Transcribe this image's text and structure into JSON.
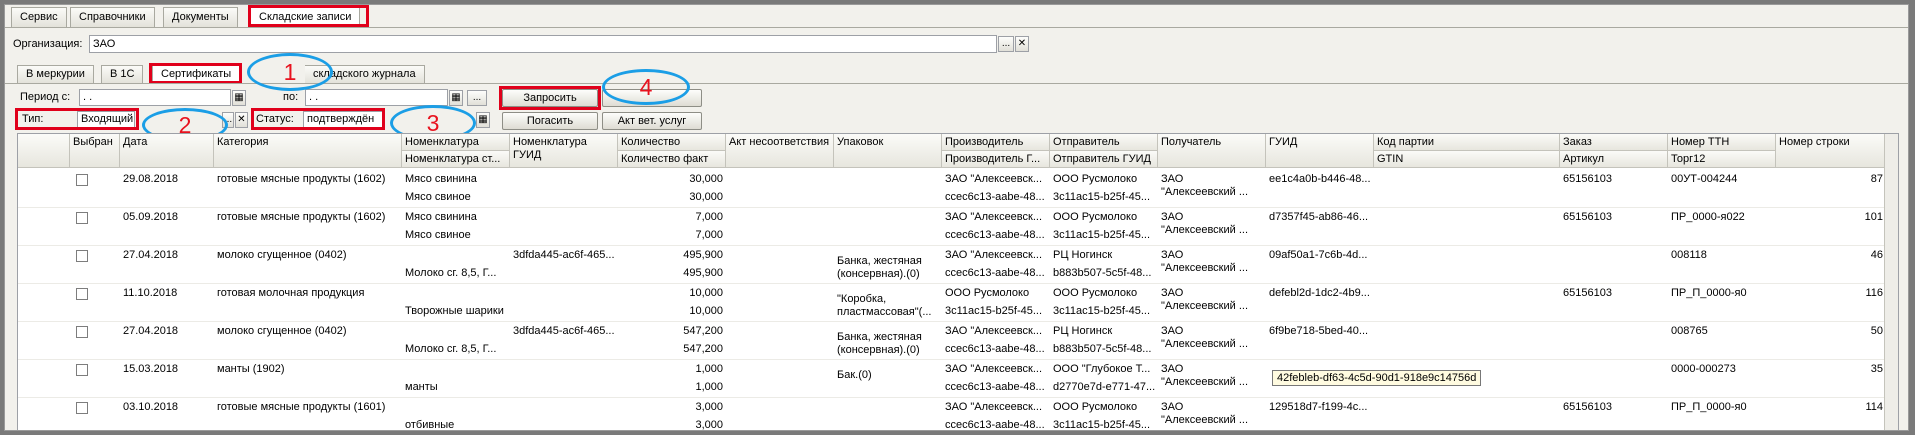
{
  "top_tabs": [
    "Сервис",
    "Справочники",
    "Документы",
    "Складские записи"
  ],
  "organization": {
    "label": "Организация:",
    "value": "ЗАО"
  },
  "sub_tabs": [
    "В меркурии",
    "В 1С",
    "Сертификаты",
    "складского журнала"
  ],
  "filters": {
    "period_from_label": "Период с:",
    "period_from_value": ". .",
    "period_to_label": "по:",
    "period_to_value": ". .",
    "type_label": "Тип:",
    "type_value": "Входящий",
    "status_label": "Статус:",
    "status_value": "подтверждён"
  },
  "buttons": {
    "request": "Запросить",
    "repay": "Погасить",
    "vet_act": "Акт вет. услуг",
    "dots": "..."
  },
  "callouts": [
    "1",
    "2",
    "3",
    "4"
  ],
  "columns": {
    "top": [
      "Выбран",
      "Дата",
      "Категория",
      "Номенклатура",
      "Номенклатура ГУИД",
      "Количество",
      "Акт несоответствия",
      "Упаковок",
      "Производитель",
      "Отправитель",
      "Получатель",
      "ГУИД",
      "Код партии",
      "Заказ",
      "Номер ТТН",
      "Номер строки"
    ],
    "bottom_nomen": "Номенклатура ст...",
    "bottom_qty": "Количество факт",
    "bottom_prod": "Производитель Г...",
    "bottom_sender": "Отправитель ГУИД",
    "bottom_batch": "GTIN",
    "bottom_order": "Артикул",
    "bottom_ttn": "Торг12"
  },
  "rows": [
    {
      "date": "29.08.2018",
      "category": "готовые мясные продукты (1602)",
      "nomen1": "Мясо свинина",
      "nomen2": "Мясо свиное",
      "nguid": "",
      "qty1": "30,000",
      "qty2": "30,000",
      "pack1": "",
      "pack2": "",
      "prod1": "ЗАО \"Алексеевск...",
      "prod2": "cceс6c13-aabe-48...",
      "send1": "ООО Русмолоко",
      "send2": "3c11ac15-b25f-45...",
      "recv1": "ЗАО",
      "recv2": "\"Алексеевский ...",
      "guid": "ee1c4a0b-b446-48...",
      "order": "65156103",
      "ttn": "00УТ-004244",
      "line": "87"
    },
    {
      "date": "05.09.2018",
      "category": "готовые мясные продукты (1602)",
      "nomen1": "Мясо свинина",
      "nomen2": "Мясо свиное",
      "nguid": "",
      "qty1": "7,000",
      "qty2": "7,000",
      "pack1": "",
      "pack2": "",
      "prod1": "ЗАО \"Алексеевск...",
      "prod2": "cceс6c13-aabe-48...",
      "send1": "ООО Русмолоко",
      "send2": "3c11ac15-b25f-45...",
      "recv1": "ЗАО",
      "recv2": "\"Алексеевский ...",
      "guid": "d7357f45-ab86-46...",
      "order": "65156103",
      "ttn": "ПР_0000-я022",
      "line": "101"
    },
    {
      "date": "27.04.2018",
      "category": "молоко сгущенное (0402)",
      "nomen1": "",
      "nomen2": "Молоко сг. 8,5, Г...",
      "nguid": "3dfda445-ac6f-465...",
      "qty1": "495,900",
      "qty2": "495,900",
      "pack1": "Банка, жестяная",
      "pack2": "(консервная).(0)",
      "prod1": "ЗАО \"Алексеевск...",
      "prod2": "cceс6c13-aabe-48...",
      "send1": "РЦ Ногинск",
      "send2": "b883b507-5c5f-48...",
      "recv1": "ЗАО",
      "recv2": "\"Алексеевский ...",
      "guid": "09af50a1-7c6b-4d...",
      "order": "",
      "ttn": "008118",
      "line": "46"
    },
    {
      "date": "11.10.2018",
      "category": "готовая молочная продукция",
      "nomen1": "",
      "nomen2": "Творожные шарики",
      "nguid": "",
      "qty1": "10,000",
      "qty2": "10,000",
      "pack1": "\"Коробка,",
      "pack2": "пластмассовая\"(...",
      "prod1": "ООО Русмолоко",
      "prod2": "3c11ac15-b25f-45...",
      "send1": "ООО Русмолоко",
      "send2": "3c11ac15-b25f-45...",
      "recv1": "ЗАО",
      "recv2": "\"Алексеевский ...",
      "guid": "defebl2d-1dc2-4b9...",
      "order": "65156103",
      "ttn": "ПР_П_0000-я0",
      "line": "116"
    },
    {
      "date": "27.04.2018",
      "category": "молоко сгущенное (0402)",
      "nomen1": "",
      "nomen2": "Молоко сг. 8,5, Г...",
      "nguid": "3dfda445-ac6f-465...",
      "qty1": "547,200",
      "qty2": "547,200",
      "pack1": "Банка, жестяная",
      "pack2": "(консервная).(0)",
      "prod1": "ЗАО \"Алексеевск...",
      "prod2": "cceс6c13-aabe-48...",
      "send1": "РЦ Ногинск",
      "send2": "b883b507-5c5f-48...",
      "recv1": "ЗАО",
      "recv2": "\"Алексеевский ...",
      "guid": "6f9be718-5bed-40...",
      "order": "",
      "ttn": "008765",
      "line": "50"
    },
    {
      "date": "15.03.2018",
      "category": "манты (1902)",
      "nomen1": "",
      "nomen2": "манты",
      "nguid": "",
      "qty1": "1,000",
      "qty2": "1,000",
      "pack1": "Бак.(0)",
      "pack2": "",
      "prod1": "ЗАО \"Алексеевск...",
      "prod2": "cceс6c13-aabe-48...",
      "send1": "ООО \"Глубокое Т...",
      "send2": "d2770e7d-e771-47...",
      "recv1": "ЗАО",
      "recv2": "\"Алексеевский ...",
      "guid": "",
      "order": "",
      "ttn": "0000-000273",
      "line": "35"
    },
    {
      "date": "03.10.2018",
      "category": "готовые мясные продукты (1601)",
      "nomen1": "",
      "nomen2": "отбивные",
      "nguid": "",
      "qty1": "3,000",
      "qty2": "3,000",
      "pack1": "",
      "pack2": "",
      "prod1": "ЗАО \"Алексеевск...",
      "prod2": "cceс6c13-aabe-48...",
      "send1": "ООО Русмолоко",
      "send2": "3c11ac15-b25f-45...",
      "recv1": "ЗАО",
      "recv2": "\"Алексеевский ...",
      "guid": "129518d7-f199-4c...",
      "order": "65156103",
      "ttn": "ПР_П_0000-я0",
      "line": "114"
    }
  ],
  "tooltip": "42febleb-df63-4c5d-90d1-918e9c14756d"
}
